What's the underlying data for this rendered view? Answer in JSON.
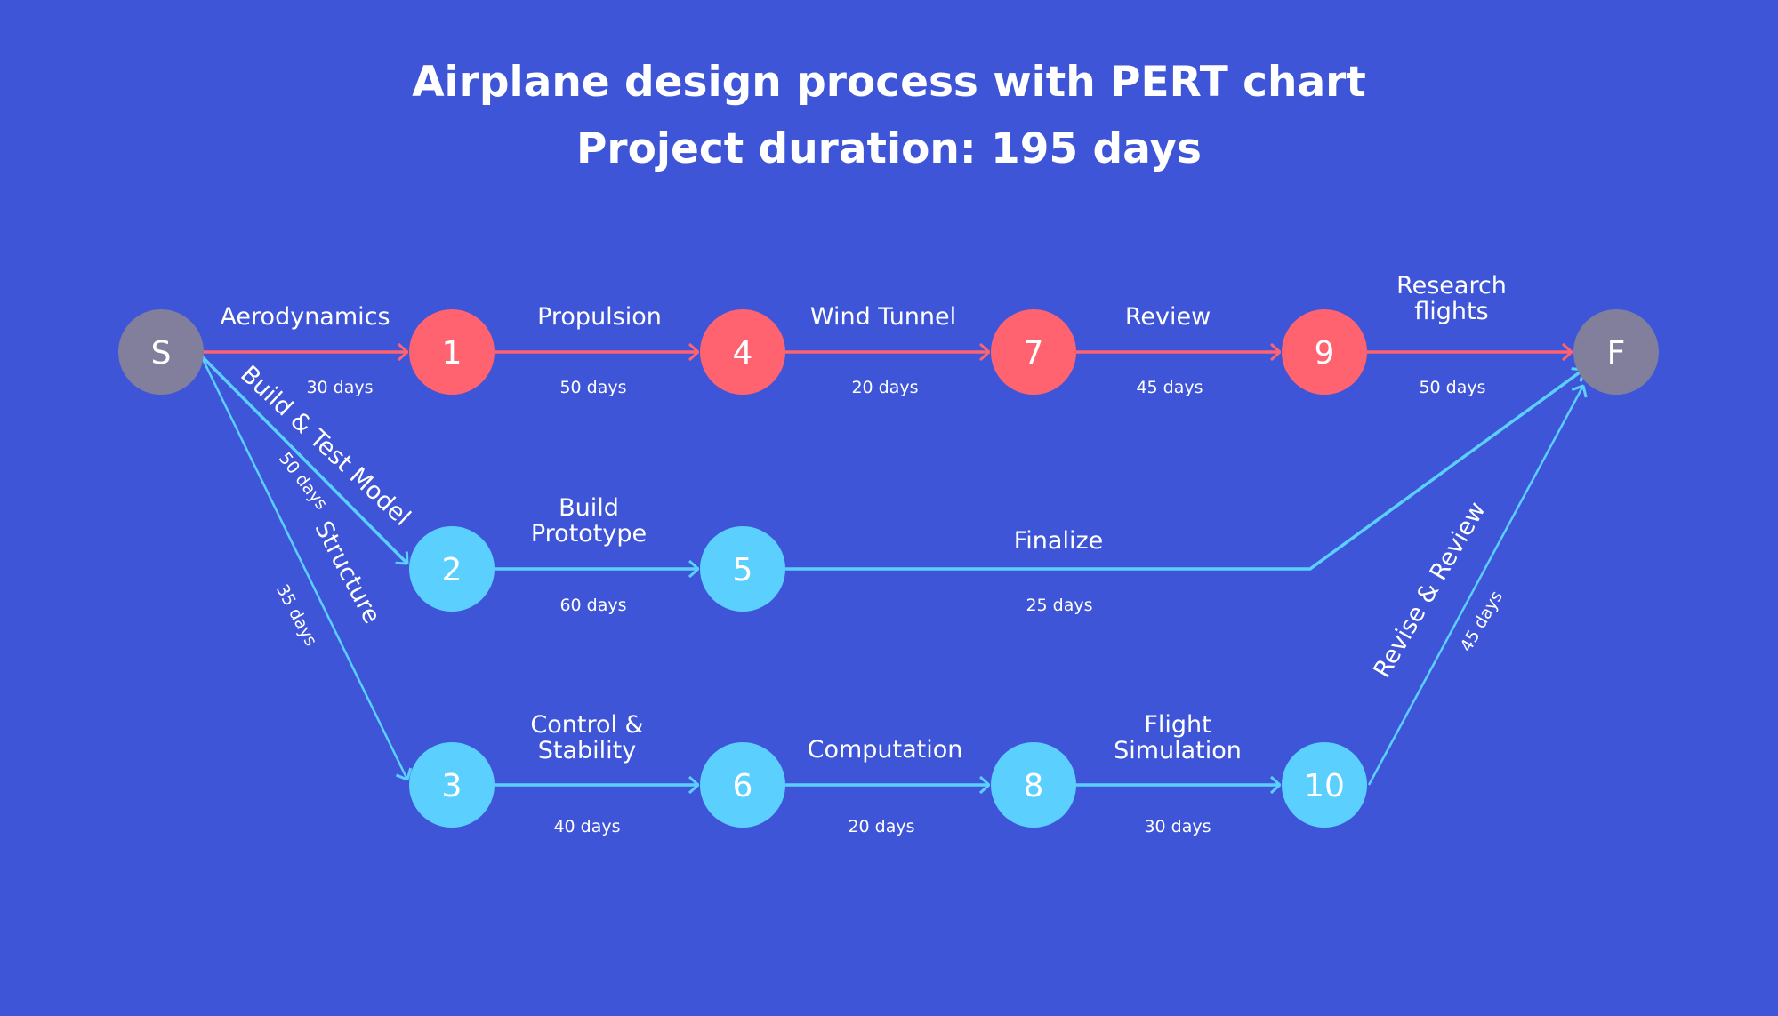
{
  "header": {
    "title": "Airplane design process with PERT chart",
    "subtitle": "Project duration: 195 days"
  },
  "colors": {
    "background": "#3f55d8",
    "critical": "#ff6370",
    "non_critical": "#5bd0ff",
    "terminal": "#827f9c",
    "text": "#ffffff"
  },
  "nodes": [
    {
      "id": "S",
      "label": "S",
      "type": "terminal"
    },
    {
      "id": "1",
      "label": "1",
      "type": "critical"
    },
    {
      "id": "4",
      "label": "4",
      "type": "critical"
    },
    {
      "id": "7",
      "label": "7",
      "type": "critical"
    },
    {
      "id": "9",
      "label": "9",
      "type": "critical"
    },
    {
      "id": "F",
      "label": "F",
      "type": "terminal"
    },
    {
      "id": "2",
      "label": "2",
      "type": "non_critical"
    },
    {
      "id": "5",
      "label": "5",
      "type": "non_critical"
    },
    {
      "id": "3",
      "label": "3",
      "type": "non_critical"
    },
    {
      "id": "6",
      "label": "6",
      "type": "non_critical"
    },
    {
      "id": "8",
      "label": "8",
      "type": "non_critical"
    },
    {
      "id": "10",
      "label": "10",
      "type": "non_critical"
    }
  ],
  "tasks": [
    {
      "from": "S",
      "to": "1",
      "name": "Aerodynamics",
      "duration": "30 days",
      "type": "critical"
    },
    {
      "from": "1",
      "to": "4",
      "name": "Propulsion",
      "duration": "50 days",
      "type": "critical"
    },
    {
      "from": "4",
      "to": "7",
      "name": "Wind Tunnel",
      "duration": "20 days",
      "type": "critical"
    },
    {
      "from": "7",
      "to": "9",
      "name": "Review",
      "duration": "45 days",
      "type": "critical"
    },
    {
      "from": "9",
      "to": "F",
      "name": "Research flights",
      "name_lines": [
        "Research",
        "flights"
      ],
      "duration": "50 days",
      "type": "critical"
    },
    {
      "from": "S",
      "to": "2",
      "name": "Build & Test Model",
      "duration": "50 days",
      "type": "non_critical"
    },
    {
      "from": "2",
      "to": "5",
      "name": "Build Prototype",
      "name_lines": [
        "Build",
        "Prototype"
      ],
      "duration": "60 days",
      "type": "non_critical"
    },
    {
      "from": "5",
      "to": "F",
      "name": "Finalize",
      "duration": "25 days",
      "type": "non_critical"
    },
    {
      "from": "S",
      "to": "3",
      "name": "Structure",
      "duration": "35 days",
      "type": "non_critical"
    },
    {
      "from": "3",
      "to": "6",
      "name": "Control & Stability",
      "name_lines": [
        "Control &",
        "Stability"
      ],
      "duration": "40 days",
      "type": "non_critical"
    },
    {
      "from": "6",
      "to": "8",
      "name": "Computation",
      "duration": "20 days",
      "type": "non_critical"
    },
    {
      "from": "8",
      "to": "10",
      "name": "Flight Simulation",
      "name_lines": [
        "Flight",
        "Simulation"
      ],
      "duration": "30 days",
      "type": "non_critical"
    },
    {
      "from": "10",
      "to": "F",
      "name": "Revise & Review",
      "duration": "45 days",
      "type": "non_critical"
    }
  ]
}
